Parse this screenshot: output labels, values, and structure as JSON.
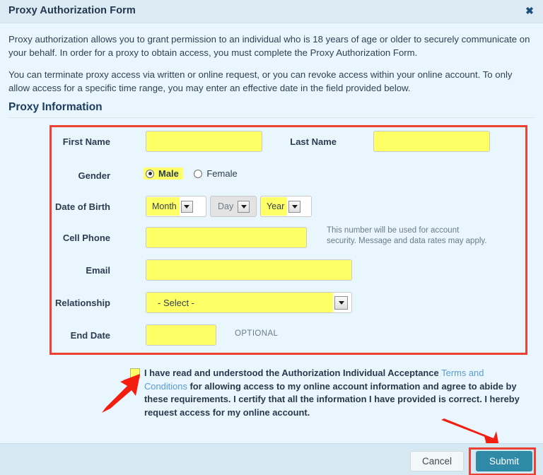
{
  "window": {
    "title": "Proxy Authorization Form",
    "close_icon": "close-icon",
    "close_glyph": "✖"
  },
  "intro": {
    "paragraph1": "Proxy authorization allows you to grant permission to an individual who is 18 years of age or older to securely communicate on your behalf. In order for a proxy to obtain access, you must complete the Proxy Authorization Form.",
    "paragraph2": "You can terminate proxy access via written or online request, or you can revoke access within your online account. To only allow access for a specific time range, you may enter an effective date in the field provided below."
  },
  "section": {
    "heading": "Proxy Information"
  },
  "form": {
    "first_name": {
      "label": "First Name",
      "value": "",
      "placeholder": ""
    },
    "last_name": {
      "label": "Last Name",
      "value": "",
      "placeholder": ""
    },
    "gender": {
      "label": "Gender",
      "options": [
        "Male",
        "Female"
      ],
      "selected": "Male"
    },
    "date_of_birth": {
      "label": "Date of Birth",
      "month": {
        "value": "Month",
        "enabled": true
      },
      "day": {
        "value": "Day",
        "enabled": false
      },
      "year": {
        "value": "Year",
        "enabled": true
      }
    },
    "cell_phone": {
      "label": "Cell Phone",
      "value": "",
      "helper_line1": "This number will be used for account",
      "helper_line2": "security. Message and data rates may apply."
    },
    "email": {
      "label": "Email",
      "value": ""
    },
    "relationship": {
      "label": "Relationship",
      "value": "- Select -"
    },
    "end_date": {
      "label": "End Date",
      "value": "",
      "optional_tag": "OPTIONAL"
    }
  },
  "consent": {
    "checked": false,
    "text_before": "I have read and understood the Authorization Individual Acceptance ",
    "link_text": "Terms and Conditions",
    "text_after": " for allowing access to my online account information and agree to abide by these requirements. I certify that all the information I have provided is correct. I hereby request access for my online account."
  },
  "footer": {
    "cancel_label": "Cancel",
    "submit_label": "Submit"
  },
  "annotations": {
    "arrow_to_checkbox": "red-arrow-pointing-to-consent-checkbox",
    "arrow_to_submit": "red-arrow-pointing-to-submit-button",
    "highlight_box": "red-rectangle-around-proxy-information-fields",
    "highlight_submit": "red-rectangle-around-submit-button"
  },
  "colors": {
    "header_bg": "#dceaf3",
    "body_bg": "#eaf6fd",
    "footer_bg": "#d6e9f2",
    "field_highlight": "#ffff66",
    "annotation_red": "#ee4136",
    "submit_blue": "#2f8aa8",
    "link_blue": "#5b9bd5"
  }
}
